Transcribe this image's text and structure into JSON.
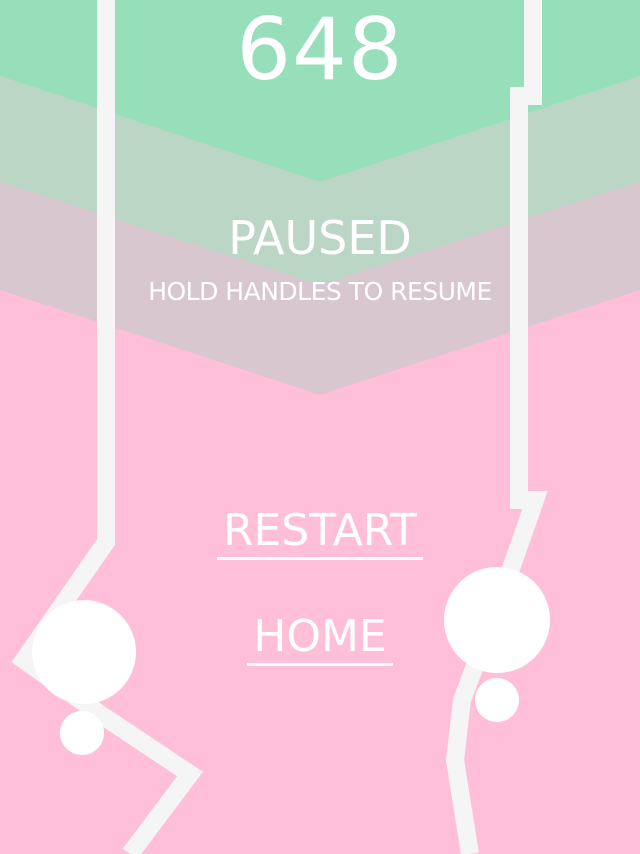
{
  "colors": {
    "top_band": "#97dfbb",
    "middle_band": "#bcd6c6",
    "lower_band": "#d9c7cf",
    "background": "#ffbfd8",
    "track": "#f5f5f5",
    "handle": "#ffffff"
  },
  "hud": {
    "score": "648"
  },
  "pause_overlay": {
    "title": "PAUSED",
    "subtitle": "HOLD HANDLES TO RESUME"
  },
  "menu": {
    "restart_label": "RESTART",
    "home_label": "HOME"
  }
}
